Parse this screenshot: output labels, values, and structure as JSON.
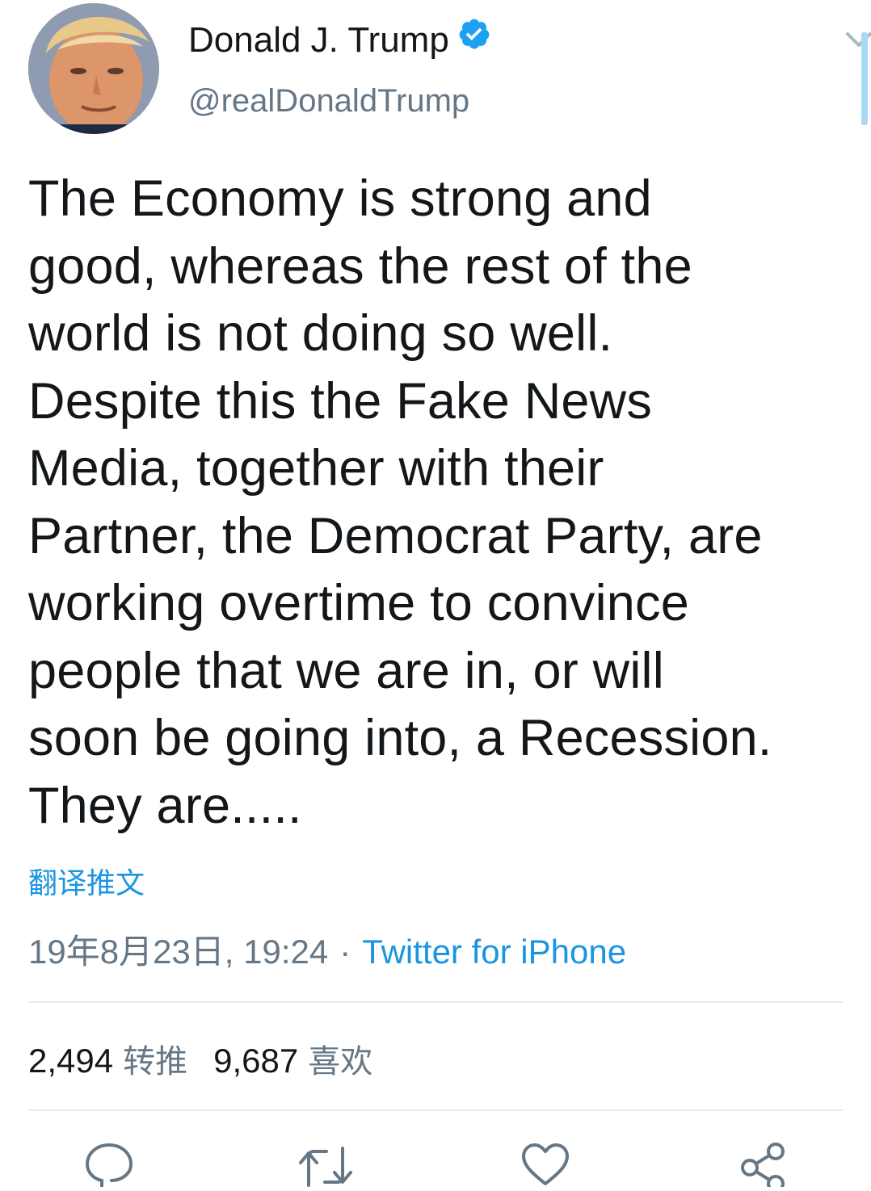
{
  "user": {
    "display_name": "Donald J. Trump",
    "handle": "@realDonaldTrump",
    "verified": true,
    "avatar_icon": "profile-photo"
  },
  "tweet": {
    "text": "The Economy is strong and\ngood, whereas the rest of the\nworld is not doing so well.\nDespite this the Fake News\nMedia, together with their\nPartner, the Democrat Party, are\nworking overtime to convince\npeople that we are in, or will\nsoon be going into, a Recession.\nThey are.....",
    "translate_label": "翻译推文",
    "timestamp": "19年8月23日, 19:24",
    "separator": "·",
    "source": "Twitter for iPhone"
  },
  "stats": {
    "retweets_count": "2,494",
    "retweets_label": "转推",
    "likes_count": "9,687",
    "likes_label": "喜欢"
  },
  "actions": {
    "reply_icon": "reply-icon",
    "retweet_icon": "retweet-icon",
    "like_icon": "heart-icon",
    "share_icon": "share-icon"
  },
  "colors": {
    "accent": "#1b95e0",
    "verified": "#1da1f2",
    "secondary_text": "#657786",
    "primary_text": "#14171a",
    "divider": "#e6ecf0"
  }
}
